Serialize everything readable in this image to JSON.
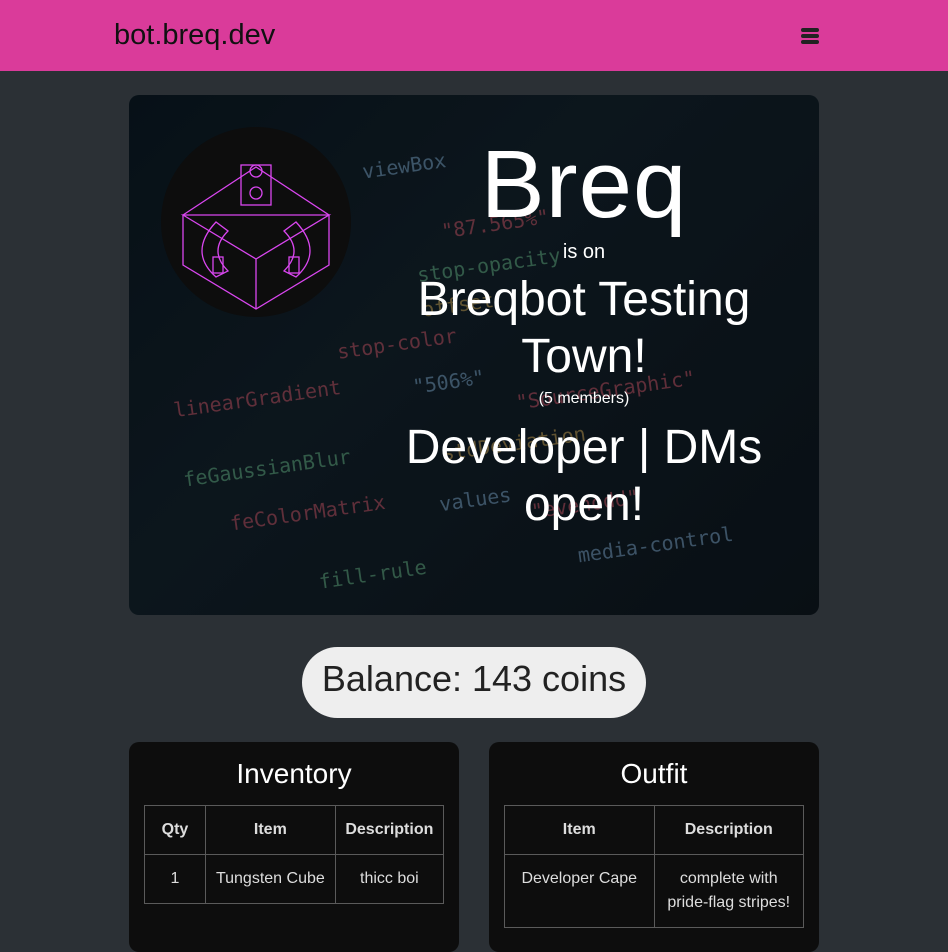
{
  "nav": {
    "brand": "bot.breq.dev",
    "menu_icon": "hamburger-icon"
  },
  "profile": {
    "username": "Breq",
    "is_on": "is on",
    "server": "Breqbot Testing Town!",
    "members": "(5 members)",
    "status": "Developer | DMs open!"
  },
  "balance": {
    "text": "Balance: 143 coins"
  },
  "inventory": {
    "title": "Inventory",
    "headers": [
      "Qty",
      "Item",
      "Description"
    ],
    "rows": [
      {
        "qty": "1",
        "item": "Tungsten Cube",
        "description": "thicc boi"
      }
    ]
  },
  "outfit": {
    "title": "Outfit",
    "headers": [
      "Item",
      "Description"
    ],
    "rows": [
      {
        "item": "Developer Cape",
        "description": "complete with pride-flag stripes!"
      }
    ]
  },
  "colors": {
    "nav": "#da3b9a",
    "page": "#2b3035",
    "accent_avatar": "#d946ef"
  }
}
